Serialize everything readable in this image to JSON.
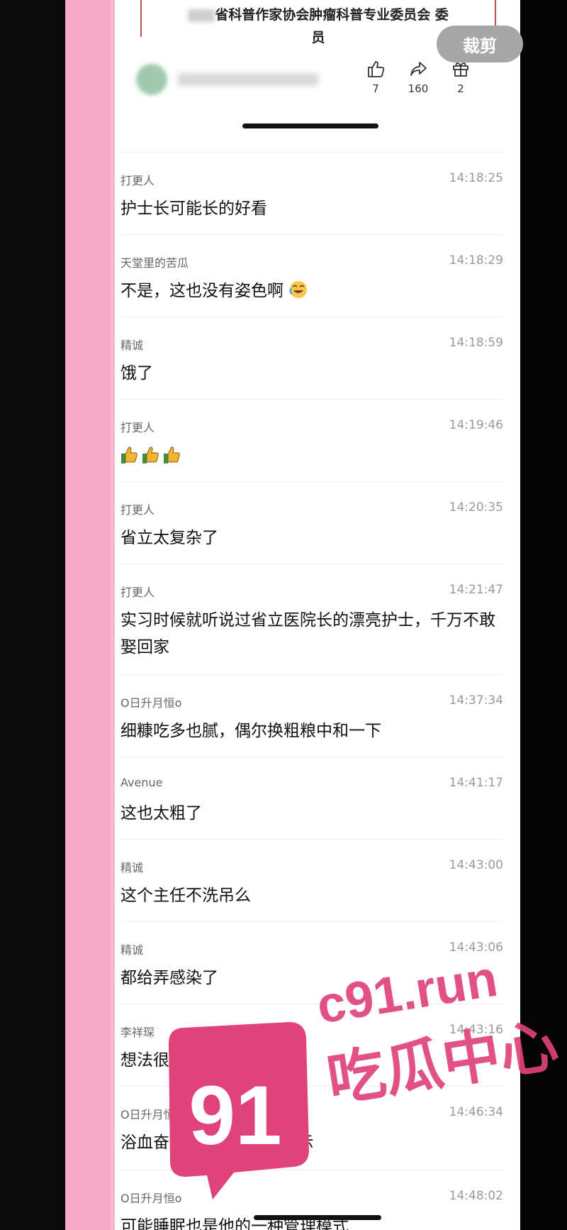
{
  "post": {
    "card_line1": "省科普作家协会肿瘤科普专业委员会  委",
    "card_line2": "员"
  },
  "crop_button": "裁剪",
  "actions": [
    {
      "icon": "thumb-up-icon",
      "count": "7"
    },
    {
      "icon": "share-icon",
      "count": "160"
    },
    {
      "icon": "gift-icon",
      "count": "2"
    }
  ],
  "comments": [
    {
      "user": "打更人",
      "time": "14:18:25",
      "text": "护士长可能长的好看"
    },
    {
      "user": "天堂里的苦瓜",
      "time": "14:18:29",
      "text": "不是，这也没有姿色啊",
      "emoji": "laugh-cry-emoji"
    },
    {
      "user": "精诚",
      "time": "14:18:59",
      "text": "饿了"
    },
    {
      "user": "打更人",
      "time": "14:19:46",
      "text": "",
      "emoji": "thumbs-up-emoji-x3"
    },
    {
      "user": "打更人",
      "time": "14:20:35",
      "text": "省立太复杂了"
    },
    {
      "user": "打更人",
      "time": "14:21:47",
      "text": "实习时候就听说过省立医院长的漂亮护士，千万不敢娶回家"
    },
    {
      "user": "O日升月恒o",
      "time": "14:37:34",
      "text": "细糠吃多也腻，偶尔换粗粮中和一下"
    },
    {
      "user": "Avenue",
      "time": "14:41:17",
      "text": "这也太粗了"
    },
    {
      "user": "精诚",
      "time": "14:43:00",
      "text": "这个主任不洗吊么"
    },
    {
      "user": "精诚",
      "time": "14:43:06",
      "text": "都给弄感染了"
    },
    {
      "user": "李祥琛",
      "time": "14:43:16",
      "text": "想法很危险"
    },
    {
      "user": "O日升月恒o",
      "time": "14:46:34",
      "text_before": "浴血奋战吧",
      "text_after": "图里有提示",
      "emoji": "grin-emoji"
    },
    {
      "user": "O日升月恒o",
      "time": "14:48:02",
      "text": "可能睡眠也是他的一种管理模式"
    }
  ],
  "watermark": {
    "badge": "91",
    "domain": "c91.run",
    "slogan": "吃瓜中心"
  },
  "colors": {
    "pink_bar": "#f7a8c6",
    "watermark": "#e0427c",
    "text": "#111111",
    "meta": "#999999"
  }
}
